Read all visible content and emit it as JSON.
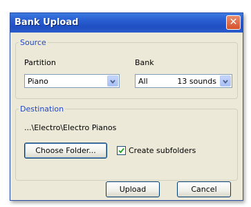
{
  "window": {
    "title": "Bank Upload",
    "close_symbol": "✕"
  },
  "source": {
    "legend": "Source",
    "partition_label": "Partition",
    "partition_value": "Piano",
    "bank_label": "Bank",
    "bank_value": "All",
    "bank_count": "13 sounds"
  },
  "destination": {
    "legend": "Destination",
    "path": "...\\Electro\\Electro Pianos",
    "choose_folder_label": "Choose Folder...",
    "create_subfolders_label": "Create subfolders",
    "create_subfolders_checked": true
  },
  "buttons": {
    "upload_label": "Upload",
    "cancel_label": "Cancel"
  },
  "icons": {
    "close": "close-icon",
    "dropdown": "chevron-down-icon",
    "check": "checkmark-icon"
  },
  "colors": {
    "titlebar": "#2a5fd2",
    "close_button": "#d5532c",
    "legend_text": "#1f48c6",
    "dialog_background": "#ece9d8"
  }
}
